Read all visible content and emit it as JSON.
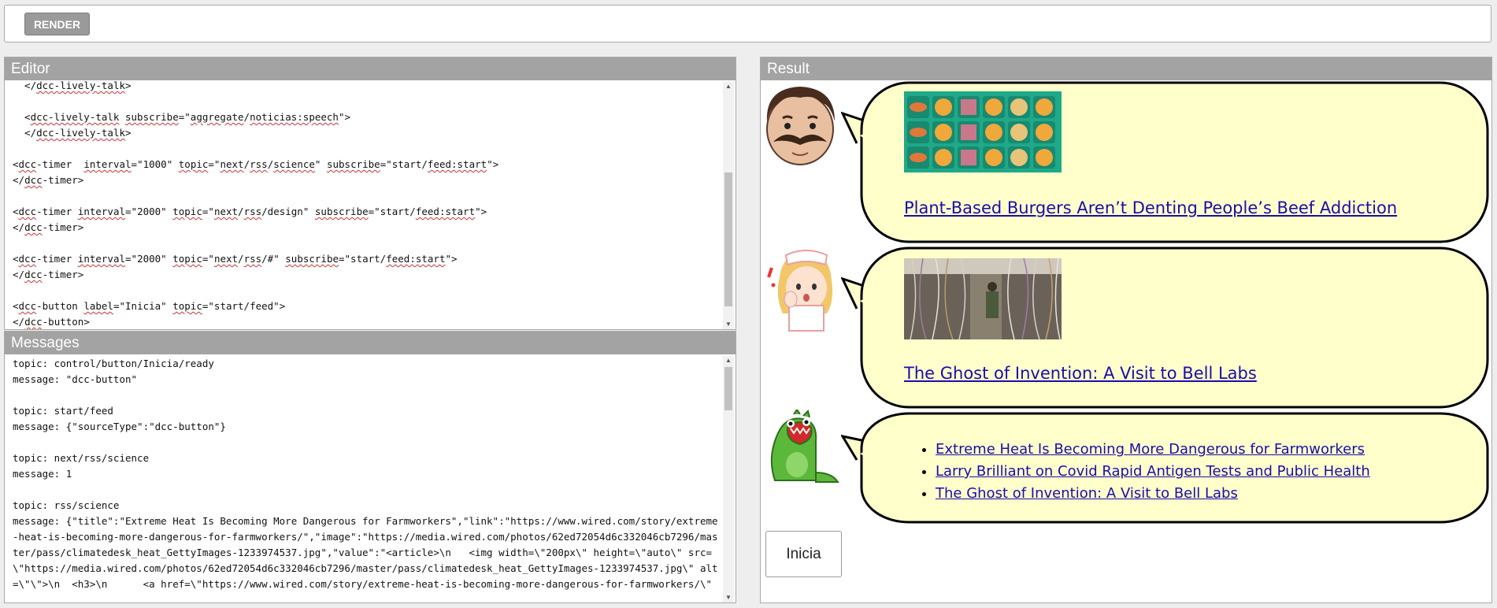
{
  "toolbar": {
    "render_label": "RENDER"
  },
  "editor": {
    "title": "Editor",
    "lines": [
      [
        {
          "t": "  </"
        },
        {
          "t": "dcc-lively-talk",
          "u": true
        },
        {
          "t": ">"
        }
      ],
      [
        {
          "t": ""
        }
      ],
      [
        {
          "t": "  <"
        },
        {
          "t": "dcc-lively-talk",
          "u": true
        },
        {
          "t": " "
        },
        {
          "t": "subscribe",
          "u": true
        },
        {
          "t": "=\""
        },
        {
          "t": "aggregate",
          "u": true
        },
        {
          "t": "/"
        },
        {
          "t": "noticias:speech",
          "u": true
        },
        {
          "t": "\">"
        }
      ],
      [
        {
          "t": "  </"
        },
        {
          "t": "dcc-lively-talk",
          "u": true
        },
        {
          "t": ">"
        }
      ],
      [
        {
          "t": ""
        }
      ],
      [
        {
          "t": "<"
        },
        {
          "t": "dcc",
          "u": true
        },
        {
          "t": "-timer  "
        },
        {
          "t": "interval",
          "u": true
        },
        {
          "t": "=\"1000\" "
        },
        {
          "t": "topic",
          "u": true
        },
        {
          "t": "=\""
        },
        {
          "t": "next",
          "u": true
        },
        {
          "t": "/"
        },
        {
          "t": "rss",
          "u": true
        },
        {
          "t": "/"
        },
        {
          "t": "science",
          "u": true
        },
        {
          "t": "\" "
        },
        {
          "t": "subscribe",
          "u": true
        },
        {
          "t": "=\"start/"
        },
        {
          "t": "feed:start",
          "u": true
        },
        {
          "t": "\">"
        }
      ],
      [
        {
          "t": "</"
        },
        {
          "t": "dcc",
          "u": true
        },
        {
          "t": "-timer>"
        }
      ],
      [
        {
          "t": ""
        }
      ],
      [
        {
          "t": "<"
        },
        {
          "t": "dcc",
          "u": true
        },
        {
          "t": "-timer "
        },
        {
          "t": "interval",
          "u": true
        },
        {
          "t": "=\"2000\" "
        },
        {
          "t": "topic",
          "u": true
        },
        {
          "t": "=\""
        },
        {
          "t": "next",
          "u": true
        },
        {
          "t": "/"
        },
        {
          "t": "rss",
          "u": true
        },
        {
          "t": "/design\" "
        },
        {
          "t": "subscribe",
          "u": true
        },
        {
          "t": "=\"start/"
        },
        {
          "t": "feed:start",
          "u": true
        },
        {
          "t": "\">"
        }
      ],
      [
        {
          "t": "</"
        },
        {
          "t": "dcc",
          "u": true
        },
        {
          "t": "-timer>"
        }
      ],
      [
        {
          "t": ""
        }
      ],
      [
        {
          "t": "<"
        },
        {
          "t": "dcc",
          "u": true
        },
        {
          "t": "-timer "
        },
        {
          "t": "interval",
          "u": true
        },
        {
          "t": "=\"2000\" "
        },
        {
          "t": "topic",
          "u": true
        },
        {
          "t": "=\""
        },
        {
          "t": "next",
          "u": true
        },
        {
          "t": "/"
        },
        {
          "t": "rss",
          "u": true
        },
        {
          "t": "/#\" "
        },
        {
          "t": "subscribe",
          "u": true
        },
        {
          "t": "=\"start/"
        },
        {
          "t": "feed:start",
          "u": true
        },
        {
          "t": "\">"
        }
      ],
      [
        {
          "t": "</"
        },
        {
          "t": "dcc",
          "u": true
        },
        {
          "t": "-timer>"
        }
      ],
      [
        {
          "t": ""
        }
      ],
      [
        {
          "t": "<"
        },
        {
          "t": "dcc",
          "u": true
        },
        {
          "t": "-button "
        },
        {
          "t": "label",
          "u": true
        },
        {
          "t": "=\"Inicia\" "
        },
        {
          "t": "topic",
          "u": true
        },
        {
          "t": "=\"start/feed\">"
        }
      ],
      [
        {
          "t": "</"
        },
        {
          "t": "dcc",
          "u": true
        },
        {
          "t": "-button>"
        }
      ]
    ]
  },
  "messages": {
    "title": "Messages",
    "text": "topic: control/button/Inicia/ready\nmessage: \"dcc-button\"\n\ntopic: start/feed\nmessage: {\"sourceType\":\"dcc-button\"}\n\ntopic: next/rss/science\nmessage: 1\n\ntopic: rss/science\nmessage: {\"title\":\"Extreme Heat Is Becoming More Dangerous for Farmworkers\",\"link\":\"https://www.wired.com/story/extreme-heat-is-becoming-more-dangerous-for-farmworkers/\",\"image\":\"https://media.wired.com/photos/62ed72054d6c332046cb7296/master/pass/climatedesk_heat_GettyImages-1233974537.jpg\",\"value\":\"<article>\\n   <img width=\\\"200px\\\" height=\\\"auto\\\" src=\\\"https://media.wired.com/photos/62ed72054d6c332046cb7296/master/pass/climatedesk_heat_GettyImages-1233974537.jpg\\\" alt=\\\"\\\">\\n  <h3>\\n      <a href=\\\"https://www.wired.com/story/extreme-heat-is-becoming-more-dangerous-for-farmworkers/\\\""
  },
  "result": {
    "title": "Result",
    "bubbles": [
      {
        "title": "Plant-Based Burgers Aren’t Denting People’s Beef Addiction"
      },
      {
        "title": "The Ghost of Invention: A Visit to Bell Labs"
      },
      {
        "items": [
          "Extreme Heat Is Becoming More Dangerous for Farmworkers",
          "Larry Brilliant on Covid Rapid Antigen Tests and Public Health",
          "The Ghost of Invention: A Visit to Bell Labs"
        ]
      }
    ],
    "button_label": "Inicia"
  },
  "colors": {
    "bubble_fill": "#ffffcc",
    "header_bg": "#a3a3a3",
    "link": "#1a0dab"
  },
  "icons": [
    "man-mustache-avatar",
    "nurse-avatar",
    "green-dinosaur-avatar",
    "scroll-up-arrow",
    "scroll-down-arrow"
  ]
}
